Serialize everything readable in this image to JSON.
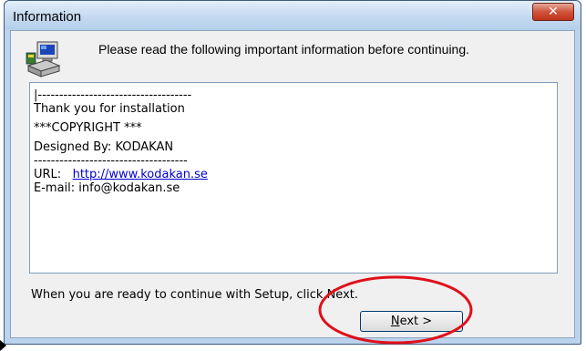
{
  "window": {
    "title": "Information",
    "close_glyph": "✕"
  },
  "header": {
    "text": "Please read the following important information before continuing.",
    "icon": "setup-computer-icon"
  },
  "info": {
    "lines": [
      "|------------------------------------",
      "Thank you for installation",
      "***COPYRIGHT ***",
      "Designed By: KODAKAN",
      "------------------------------------"
    ],
    "url_label": "URL:",
    "url": "http://www.kodakan.se",
    "email_line": "E-mail: info@kodakan.se"
  },
  "footer": {
    "text": "When you are ready to continue with Setup, click Next."
  },
  "buttons": {
    "next_mnemonic": "N",
    "next_rest": "ext >"
  },
  "colors": {
    "highlight": "#e0101a",
    "link": "#0000cc",
    "window_frame": "#bcd3ee"
  }
}
